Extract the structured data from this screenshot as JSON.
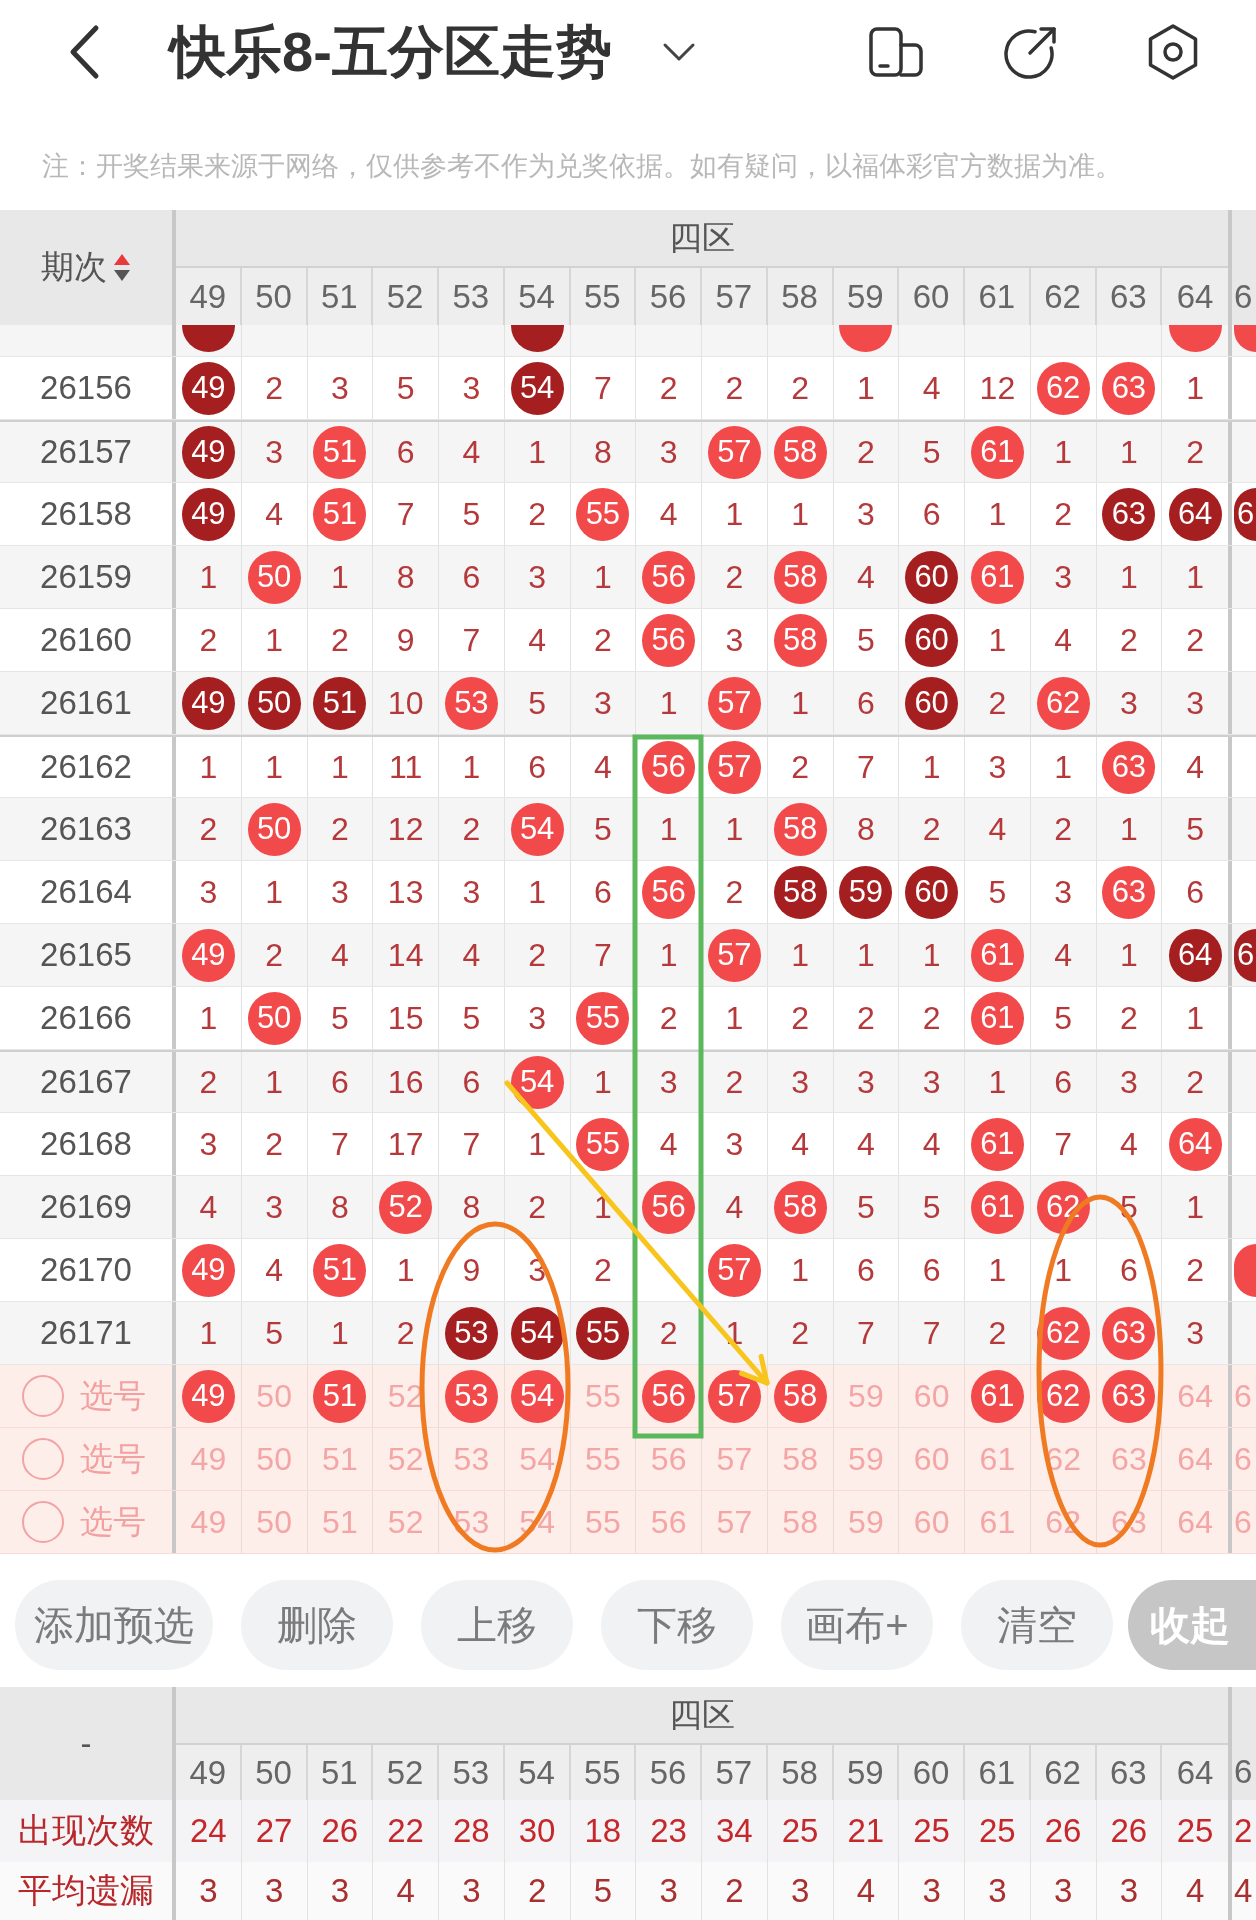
{
  "header": {
    "title": "快乐8-五分区走势"
  },
  "notice": "注：开奖结果来源于网络，仅供参考不作为兑奖依据。如有疑问，以福体彩官方数据为准。",
  "trend_table": {
    "period_header": "期次",
    "sort_ascending": true,
    "zone": "四区",
    "columns": [
      "49",
      "50",
      "51",
      "52",
      "53",
      "54",
      "55",
      "56",
      "57",
      "58",
      "59",
      "60",
      "61",
      "62",
      "63",
      "64",
      "6"
    ],
    "cut_row": {
      "cells": [
        {
          "kind": "dark"
        },
        {
          "kind": "plain"
        },
        {
          "kind": "plain"
        },
        {
          "kind": "plain"
        },
        {
          "kind": "plain"
        },
        {
          "kind": "dark"
        },
        {
          "kind": "plain"
        },
        {
          "kind": "plain"
        },
        {
          "kind": "plain"
        },
        {
          "kind": "plain"
        },
        {
          "kind": "light"
        },
        {
          "kind": "plain"
        },
        {
          "kind": "plain"
        },
        {
          "kind": "plain"
        },
        {
          "kind": "plain"
        },
        {
          "kind": "light"
        },
        {
          "kind": "light"
        }
      ]
    },
    "rows": [
      {
        "period": "26156",
        "cells": [
          {
            "text": "49",
            "kind": "dark"
          },
          {
            "text": "2",
            "kind": "plain"
          },
          {
            "text": "3",
            "kind": "plain"
          },
          {
            "text": "5",
            "kind": "plain"
          },
          {
            "text": "3",
            "kind": "plain"
          },
          {
            "text": "54",
            "kind": "dark"
          },
          {
            "text": "7",
            "kind": "plain"
          },
          {
            "text": "2",
            "kind": "plain"
          },
          {
            "text": "2",
            "kind": "plain"
          },
          {
            "text": "2",
            "kind": "plain"
          },
          {
            "text": "1",
            "kind": "plain"
          },
          {
            "text": "4",
            "kind": "plain"
          },
          {
            "text": "12",
            "kind": "plain"
          },
          {
            "text": "62",
            "kind": "light"
          },
          {
            "text": "63",
            "kind": "light"
          },
          {
            "text": "1",
            "kind": "plain"
          },
          {
            "kind": "plain"
          }
        ]
      },
      {
        "period": "26157",
        "cells": [
          {
            "text": "49",
            "kind": "dark"
          },
          {
            "text": "3",
            "kind": "plain"
          },
          {
            "text": "51",
            "kind": "light"
          },
          {
            "text": "6",
            "kind": "plain"
          },
          {
            "text": "4",
            "kind": "plain"
          },
          {
            "text": "1",
            "kind": "plain"
          },
          {
            "text": "8",
            "kind": "plain"
          },
          {
            "text": "3",
            "kind": "plain"
          },
          {
            "text": "57",
            "kind": "light"
          },
          {
            "text": "58",
            "kind": "light"
          },
          {
            "text": "2",
            "kind": "plain"
          },
          {
            "text": "5",
            "kind": "plain"
          },
          {
            "text": "61",
            "kind": "light"
          },
          {
            "text": "1",
            "kind": "plain"
          },
          {
            "text": "1",
            "kind": "plain"
          },
          {
            "text": "2",
            "kind": "plain"
          },
          {
            "kind": "plain"
          }
        ]
      },
      {
        "period": "26158",
        "cells": [
          {
            "text": "49",
            "kind": "dark"
          },
          {
            "text": "4",
            "kind": "plain"
          },
          {
            "text": "51",
            "kind": "light"
          },
          {
            "text": "7",
            "kind": "plain"
          },
          {
            "text": "5",
            "kind": "plain"
          },
          {
            "text": "2",
            "kind": "plain"
          },
          {
            "text": "55",
            "kind": "light"
          },
          {
            "text": "4",
            "kind": "plain"
          },
          {
            "text": "1",
            "kind": "plain"
          },
          {
            "text": "1",
            "kind": "plain"
          },
          {
            "text": "3",
            "kind": "plain"
          },
          {
            "text": "6",
            "kind": "plain"
          },
          {
            "text": "1",
            "kind": "plain"
          },
          {
            "text": "2",
            "kind": "plain"
          },
          {
            "text": "63",
            "kind": "dark"
          },
          {
            "text": "64",
            "kind": "dark"
          },
          {
            "text": "6",
            "kind": "dark"
          }
        ]
      },
      {
        "period": "26159",
        "cells": [
          {
            "text": "1",
            "kind": "plain"
          },
          {
            "text": "50",
            "kind": "light"
          },
          {
            "text": "1",
            "kind": "plain"
          },
          {
            "text": "8",
            "kind": "plain"
          },
          {
            "text": "6",
            "kind": "plain"
          },
          {
            "text": "3",
            "kind": "plain"
          },
          {
            "text": "1",
            "kind": "plain"
          },
          {
            "text": "56",
            "kind": "light"
          },
          {
            "text": "2",
            "kind": "plain"
          },
          {
            "text": "58",
            "kind": "light"
          },
          {
            "text": "4",
            "kind": "plain"
          },
          {
            "text": "60",
            "kind": "dark"
          },
          {
            "text": "61",
            "kind": "light"
          },
          {
            "text": "3",
            "kind": "plain"
          },
          {
            "text": "1",
            "kind": "plain"
          },
          {
            "text": "1",
            "kind": "plain"
          },
          {
            "kind": "plain"
          }
        ]
      },
      {
        "period": "26160",
        "cells": [
          {
            "text": "2",
            "kind": "plain"
          },
          {
            "text": "1",
            "kind": "plain"
          },
          {
            "text": "2",
            "kind": "plain"
          },
          {
            "text": "9",
            "kind": "plain"
          },
          {
            "text": "7",
            "kind": "plain"
          },
          {
            "text": "4",
            "kind": "plain"
          },
          {
            "text": "2",
            "kind": "plain"
          },
          {
            "text": "56",
            "kind": "light"
          },
          {
            "text": "3",
            "kind": "plain"
          },
          {
            "text": "58",
            "kind": "light"
          },
          {
            "text": "5",
            "kind": "plain"
          },
          {
            "text": "60",
            "kind": "dark"
          },
          {
            "text": "1",
            "kind": "plain"
          },
          {
            "text": "4",
            "kind": "plain"
          },
          {
            "text": "2",
            "kind": "plain"
          },
          {
            "text": "2",
            "kind": "plain"
          },
          {
            "kind": "plain"
          }
        ]
      },
      {
        "period": "26161",
        "cells": [
          {
            "text": "49",
            "kind": "dark"
          },
          {
            "text": "50",
            "kind": "dark"
          },
          {
            "text": "51",
            "kind": "dark"
          },
          {
            "text": "10",
            "kind": "plain"
          },
          {
            "text": "53",
            "kind": "light"
          },
          {
            "text": "5",
            "kind": "plain"
          },
          {
            "text": "3",
            "kind": "plain"
          },
          {
            "text": "1",
            "kind": "plain"
          },
          {
            "text": "57",
            "kind": "light"
          },
          {
            "text": "1",
            "kind": "plain"
          },
          {
            "text": "6",
            "kind": "plain"
          },
          {
            "text": "60",
            "kind": "dark"
          },
          {
            "text": "2",
            "kind": "plain"
          },
          {
            "text": "62",
            "kind": "light"
          },
          {
            "text": "3",
            "kind": "plain"
          },
          {
            "text": "3",
            "kind": "plain"
          },
          {
            "kind": "plain"
          }
        ]
      },
      {
        "period": "26162",
        "cells": [
          {
            "text": "1",
            "kind": "plain"
          },
          {
            "text": "1",
            "kind": "plain"
          },
          {
            "text": "1",
            "kind": "plain"
          },
          {
            "text": "11",
            "kind": "plain"
          },
          {
            "text": "1",
            "kind": "plain"
          },
          {
            "text": "6",
            "kind": "plain"
          },
          {
            "text": "4",
            "kind": "plain"
          },
          {
            "text": "56",
            "kind": "light"
          },
          {
            "text": "57",
            "kind": "light"
          },
          {
            "text": "2",
            "kind": "plain"
          },
          {
            "text": "7",
            "kind": "plain"
          },
          {
            "text": "1",
            "kind": "plain"
          },
          {
            "text": "3",
            "kind": "plain"
          },
          {
            "text": "1",
            "kind": "plain"
          },
          {
            "text": "63",
            "kind": "light"
          },
          {
            "text": "4",
            "kind": "plain"
          },
          {
            "kind": "plain"
          }
        ]
      },
      {
        "period": "26163",
        "cells": [
          {
            "text": "2",
            "kind": "plain"
          },
          {
            "text": "50",
            "kind": "light"
          },
          {
            "text": "2",
            "kind": "plain"
          },
          {
            "text": "12",
            "kind": "plain"
          },
          {
            "text": "2",
            "kind": "plain"
          },
          {
            "text": "54",
            "kind": "light"
          },
          {
            "text": "5",
            "kind": "plain"
          },
          {
            "text": "1",
            "kind": "plain"
          },
          {
            "text": "1",
            "kind": "plain"
          },
          {
            "text": "58",
            "kind": "light"
          },
          {
            "text": "8",
            "kind": "plain"
          },
          {
            "text": "2",
            "kind": "plain"
          },
          {
            "text": "4",
            "kind": "plain"
          },
          {
            "text": "2",
            "kind": "plain"
          },
          {
            "text": "1",
            "kind": "plain"
          },
          {
            "text": "5",
            "kind": "plain"
          },
          {
            "kind": "plain"
          }
        ]
      },
      {
        "period": "26164",
        "cells": [
          {
            "text": "3",
            "kind": "plain"
          },
          {
            "text": "1",
            "kind": "plain"
          },
          {
            "text": "3",
            "kind": "plain"
          },
          {
            "text": "13",
            "kind": "plain"
          },
          {
            "text": "3",
            "kind": "plain"
          },
          {
            "text": "1",
            "kind": "plain"
          },
          {
            "text": "6",
            "kind": "plain"
          },
          {
            "text": "56",
            "kind": "light"
          },
          {
            "text": "2",
            "kind": "plain"
          },
          {
            "text": "58",
            "kind": "dark"
          },
          {
            "text": "59",
            "kind": "dark"
          },
          {
            "text": "60",
            "kind": "dark"
          },
          {
            "text": "5",
            "kind": "plain"
          },
          {
            "text": "3",
            "kind": "plain"
          },
          {
            "text": "63",
            "kind": "light"
          },
          {
            "text": "6",
            "kind": "plain"
          },
          {
            "kind": "plain"
          }
        ]
      },
      {
        "period": "26165",
        "cells": [
          {
            "text": "49",
            "kind": "light"
          },
          {
            "text": "2",
            "kind": "plain"
          },
          {
            "text": "4",
            "kind": "plain"
          },
          {
            "text": "14",
            "kind": "plain"
          },
          {
            "text": "4",
            "kind": "plain"
          },
          {
            "text": "2",
            "kind": "plain"
          },
          {
            "text": "7",
            "kind": "plain"
          },
          {
            "text": "1",
            "kind": "plain"
          },
          {
            "text": "57",
            "kind": "light"
          },
          {
            "text": "1",
            "kind": "plain"
          },
          {
            "text": "1",
            "kind": "plain"
          },
          {
            "text": "1",
            "kind": "plain"
          },
          {
            "text": "61",
            "kind": "light"
          },
          {
            "text": "4",
            "kind": "plain"
          },
          {
            "text": "1",
            "kind": "plain"
          },
          {
            "text": "64",
            "kind": "dark"
          },
          {
            "text": "6",
            "kind": "dark"
          }
        ]
      },
      {
        "period": "26166",
        "cells": [
          {
            "text": "1",
            "kind": "plain"
          },
          {
            "text": "50",
            "kind": "light"
          },
          {
            "text": "5",
            "kind": "plain"
          },
          {
            "text": "15",
            "kind": "plain"
          },
          {
            "text": "5",
            "kind": "plain"
          },
          {
            "text": "3",
            "kind": "plain"
          },
          {
            "text": "55",
            "kind": "light"
          },
          {
            "text": "2",
            "kind": "plain"
          },
          {
            "text": "1",
            "kind": "plain"
          },
          {
            "text": "2",
            "kind": "plain"
          },
          {
            "text": "2",
            "kind": "plain"
          },
          {
            "text": "2",
            "kind": "plain"
          },
          {
            "text": "61",
            "kind": "light"
          },
          {
            "text": "5",
            "kind": "plain"
          },
          {
            "text": "2",
            "kind": "plain"
          },
          {
            "text": "1",
            "kind": "plain"
          },
          {
            "kind": "plain"
          }
        ]
      },
      {
        "period": "26167",
        "cells": [
          {
            "text": "2",
            "kind": "plain"
          },
          {
            "text": "1",
            "kind": "plain"
          },
          {
            "text": "6",
            "kind": "plain"
          },
          {
            "text": "16",
            "kind": "plain"
          },
          {
            "text": "6",
            "kind": "plain"
          },
          {
            "text": "54",
            "kind": "light"
          },
          {
            "text": "1",
            "kind": "plain"
          },
          {
            "text": "3",
            "kind": "plain"
          },
          {
            "text": "2",
            "kind": "plain"
          },
          {
            "text": "3",
            "kind": "plain"
          },
          {
            "text": "3",
            "kind": "plain"
          },
          {
            "text": "3",
            "kind": "plain"
          },
          {
            "text": "1",
            "kind": "plain"
          },
          {
            "text": "6",
            "kind": "plain"
          },
          {
            "text": "3",
            "kind": "plain"
          },
          {
            "text": "2",
            "kind": "plain"
          },
          {
            "kind": "plain"
          }
        ]
      },
      {
        "period": "26168",
        "cells": [
          {
            "text": "3",
            "kind": "plain"
          },
          {
            "text": "2",
            "kind": "plain"
          },
          {
            "text": "7",
            "kind": "plain"
          },
          {
            "text": "17",
            "kind": "plain"
          },
          {
            "text": "7",
            "kind": "plain"
          },
          {
            "text": "1",
            "kind": "plain"
          },
          {
            "text": "55",
            "kind": "light"
          },
          {
            "text": "4",
            "kind": "plain"
          },
          {
            "text": "3",
            "kind": "plain"
          },
          {
            "text": "4",
            "kind": "plain"
          },
          {
            "text": "4",
            "kind": "plain"
          },
          {
            "text": "4",
            "kind": "plain"
          },
          {
            "text": "61",
            "kind": "light"
          },
          {
            "text": "7",
            "kind": "plain"
          },
          {
            "text": "4",
            "kind": "plain"
          },
          {
            "text": "64",
            "kind": "light"
          },
          {
            "kind": "plain"
          }
        ]
      },
      {
        "period": "26169",
        "cells": [
          {
            "text": "4",
            "kind": "plain"
          },
          {
            "text": "3",
            "kind": "plain"
          },
          {
            "text": "8",
            "kind": "plain"
          },
          {
            "text": "52",
            "kind": "light"
          },
          {
            "text": "8",
            "kind": "plain"
          },
          {
            "text": "2",
            "kind": "plain"
          },
          {
            "text": "1",
            "kind": "plain"
          },
          {
            "text": "56",
            "kind": "light"
          },
          {
            "text": "4",
            "kind": "plain"
          },
          {
            "text": "58",
            "kind": "light"
          },
          {
            "text": "5",
            "kind": "plain"
          },
          {
            "text": "5",
            "kind": "plain"
          },
          {
            "text": "61",
            "kind": "light"
          },
          {
            "text": "62",
            "kind": "light"
          },
          {
            "text": "5",
            "kind": "plain"
          },
          {
            "text": "1",
            "kind": "plain"
          },
          {
            "kind": "plain"
          }
        ]
      },
      {
        "period": "26170",
        "cells": [
          {
            "text": "49",
            "kind": "light"
          },
          {
            "text": "4",
            "kind": "plain"
          },
          {
            "text": "51",
            "kind": "light"
          },
          {
            "text": "1",
            "kind": "plain"
          },
          {
            "text": "9",
            "kind": "plain"
          },
          {
            "text": "3",
            "kind": "plain"
          },
          {
            "text": "2",
            "kind": "plain"
          },
          {
            "kind": "plain"
          },
          {
            "text": "57",
            "kind": "light"
          },
          {
            "text": "1",
            "kind": "plain"
          },
          {
            "text": "6",
            "kind": "plain"
          },
          {
            "text": "6",
            "kind": "plain"
          },
          {
            "text": "1",
            "kind": "plain"
          },
          {
            "text": "1",
            "kind": "plain"
          },
          {
            "text": "6",
            "kind": "plain"
          },
          {
            "text": "2",
            "kind": "plain"
          },
          {
            "kind": "light"
          }
        ]
      },
      {
        "period": "26171",
        "cells": [
          {
            "text": "1",
            "kind": "plain"
          },
          {
            "text": "5",
            "kind": "plain"
          },
          {
            "text": "1",
            "kind": "plain"
          },
          {
            "text": "2",
            "kind": "plain"
          },
          {
            "text": "53",
            "kind": "dark"
          },
          {
            "text": "54",
            "kind": "dark"
          },
          {
            "text": "55",
            "kind": "dark"
          },
          {
            "text": "2",
            "kind": "plain"
          },
          {
            "text": "1",
            "kind": "plain"
          },
          {
            "text": "2",
            "kind": "plain"
          },
          {
            "text": "7",
            "kind": "plain"
          },
          {
            "text": "7",
            "kind": "plain"
          },
          {
            "text": "2",
            "kind": "plain"
          },
          {
            "text": "62",
            "kind": "light"
          },
          {
            "text": "63",
            "kind": "light"
          },
          {
            "text": "3",
            "kind": "plain"
          },
          {
            "kind": "plain"
          }
        ]
      }
    ],
    "pick_rows": [
      {
        "label": "选号",
        "selected": false,
        "cells": [
          {
            "text": "49",
            "selected": true
          },
          {
            "text": "50",
            "selected": false
          },
          {
            "text": "51",
            "selected": true
          },
          {
            "text": "52",
            "selected": false
          },
          {
            "text": "53",
            "selected": true
          },
          {
            "text": "54",
            "selected": true
          },
          {
            "text": "55",
            "selected": false
          },
          {
            "text": "56",
            "selected": true
          },
          {
            "text": "57",
            "selected": true
          },
          {
            "text": "58",
            "selected": true
          },
          {
            "text": "59",
            "selected": false
          },
          {
            "text": "60",
            "selected": false
          },
          {
            "text": "61",
            "selected": true
          },
          {
            "text": "62",
            "selected": true
          },
          {
            "text": "63",
            "selected": true
          },
          {
            "text": "64",
            "selected": false
          },
          {
            "text": "6",
            "selected": false
          }
        ]
      },
      {
        "label": "选号",
        "selected": false,
        "cells": [
          {
            "text": "49",
            "selected": false
          },
          {
            "text": "50",
            "selected": false
          },
          {
            "text": "51",
            "selected": false
          },
          {
            "text": "52",
            "selected": false
          },
          {
            "text": "53",
            "selected": false
          },
          {
            "text": "54",
            "selected": false
          },
          {
            "text": "55",
            "selected": false
          },
          {
            "text": "56",
            "selected": false
          },
          {
            "text": "57",
            "selected": false
          },
          {
            "text": "58",
            "selected": false
          },
          {
            "text": "59",
            "selected": false
          },
          {
            "text": "60",
            "selected": false
          },
          {
            "text": "61",
            "selected": false
          },
          {
            "text": "62",
            "selected": false
          },
          {
            "text": "63",
            "selected": false
          },
          {
            "text": "64",
            "selected": false
          },
          {
            "text": "6",
            "selected": false
          }
        ]
      },
      {
        "label": "选号",
        "selected": false,
        "cells": [
          {
            "text": "49",
            "selected": false
          },
          {
            "text": "50",
            "selected": false
          },
          {
            "text": "51",
            "selected": false
          },
          {
            "text": "52",
            "selected": false
          },
          {
            "text": "53",
            "selected": false
          },
          {
            "text": "54",
            "selected": false
          },
          {
            "text": "55",
            "selected": false
          },
          {
            "text": "56",
            "selected": false
          },
          {
            "text": "57",
            "selected": false
          },
          {
            "text": "58",
            "selected": false
          },
          {
            "text": "59",
            "selected": false
          },
          {
            "text": "60",
            "selected": false
          },
          {
            "text": "61",
            "selected": false
          },
          {
            "text": "62",
            "selected": false
          },
          {
            "text": "63",
            "selected": false
          },
          {
            "text": "64",
            "selected": false
          },
          {
            "text": "6",
            "selected": false
          }
        ]
      }
    ]
  },
  "annotations": [
    {
      "kind": "rectangle",
      "color": "#5cb85c"
    },
    {
      "kind": "ellipse",
      "color": "#f07a22"
    },
    {
      "kind": "ellipse",
      "color": "#f07a22"
    },
    {
      "kind": "arrow",
      "color": "#f8c51c"
    }
  ],
  "toolbar": [
    {
      "label": "添加预选",
      "kind": "pill"
    },
    {
      "label": "删除",
      "kind": "pill"
    },
    {
      "label": "上移",
      "kind": "pill"
    },
    {
      "label": "下移",
      "kind": "pill"
    },
    {
      "label": "画布+",
      "kind": "pill"
    },
    {
      "label": "清空",
      "kind": "pill"
    },
    {
      "label": "收起",
      "kind": "collapse"
    }
  ],
  "stats_table": {
    "corner": "-",
    "zone": "四区",
    "columns": [
      "49",
      "50",
      "51",
      "52",
      "53",
      "54",
      "55",
      "56",
      "57",
      "58",
      "59",
      "60",
      "61",
      "62",
      "63",
      "64",
      "6"
    ],
    "rows": [
      {
        "label": "出现次数",
        "kind": "count",
        "values": [
          "24",
          "27",
          "26",
          "22",
          "28",
          "30",
          "18",
          "23",
          "34",
          "25",
          "21",
          "25",
          "25",
          "26",
          "26",
          "25",
          "2"
        ]
      },
      {
        "label": "平均遗漏",
        "kind": "average",
        "values": [
          "3",
          "3",
          "3",
          "4",
          "3",
          "2",
          "5",
          "3",
          "2",
          "3",
          "4",
          "3",
          "3",
          "3",
          "3",
          "4",
          "4"
        ]
      }
    ]
  }
}
